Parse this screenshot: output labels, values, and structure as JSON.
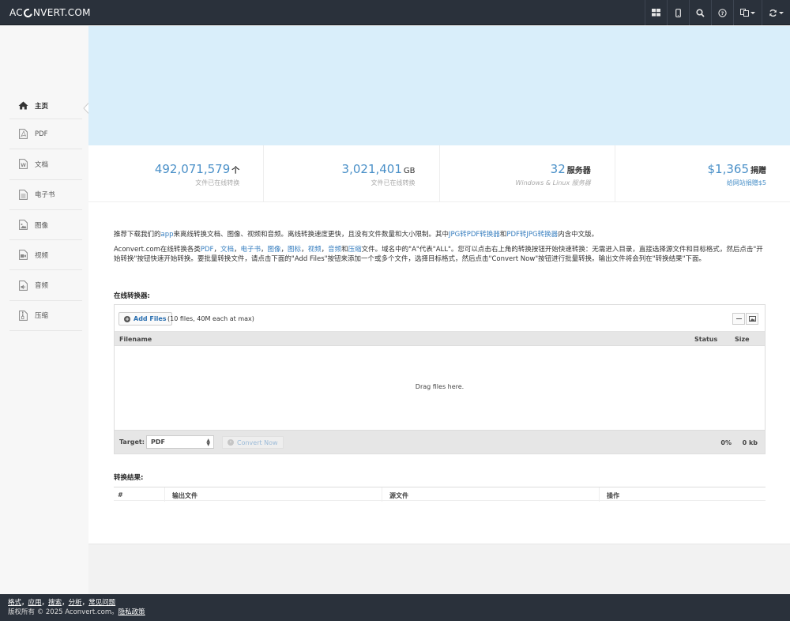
{
  "header": {
    "logo_left": "AC",
    "logo_right": "NVERT.COM"
  },
  "sidebar": {
    "items": [
      {
        "label": "主页",
        "icon": "home-icon"
      },
      {
        "label": "PDF",
        "icon": "pdf-file-icon"
      },
      {
        "label": "文档",
        "icon": "word-file-icon"
      },
      {
        "label": "电子书",
        "icon": "ebook-file-icon"
      },
      {
        "label": "图像",
        "icon": "image-file-icon"
      },
      {
        "label": "视频",
        "icon": "video-file-icon"
      },
      {
        "label": "音频",
        "icon": "audio-file-icon"
      },
      {
        "label": "压缩",
        "icon": "archive-file-icon"
      }
    ]
  },
  "stats": [
    {
      "value": "492,071,579",
      "unit": "个",
      "sub": "文件已在线转换"
    },
    {
      "value": "3,021,401",
      "unit": "GB",
      "sub": "文件已在线转换"
    },
    {
      "value": "32",
      "unit": "服务器",
      "sub": "Windows & Linux 服务器"
    },
    {
      "value": "$1,365",
      "unit": "捐赠",
      "sub": "给网站捐赠$5"
    }
  ],
  "intro": {
    "p1_a": "推荐下载我们的",
    "p1_app": "app",
    "p1_b": "来离线转换文档、图像、视频和音频。离线转换速度更快，且没有文件数量和大小限制。其中",
    "p1_link1": "JPG转PDF转换器",
    "p1_c": "和",
    "p1_link2": "PDF转JPG转换器",
    "p1_d": "内含中文版。",
    "p2_a": "Aconvert.com在线转换各类",
    "p2_pdf": "PDF",
    "p2_sep1": "，",
    "p2_doc": "文档",
    "p2_sep2": "，",
    "p2_ebook": "电子书",
    "p2_sep3": "，",
    "p2_image": "图像",
    "p2_sep4": "，",
    "p2_icon": "图标",
    "p2_sep5": "，",
    "p2_video": "视频",
    "p2_sep6": "，",
    "p2_audio": "音频",
    "p2_and": "和",
    "p2_archive": "压缩",
    "p2_b": "文件。域名中的\"A\"代表\"ALL\"。您可以点击右上角的转换按钮开始快速转换：无需进入目录，直接选择源文件和目标格式，然后点击\"开始转换\"按钮快速开始转换。要批量转换文件，请点击下面的\"Add Files\"按钮来添加一个或多个文件，选择目标格式，然后点击\"Convert Now\"按钮进行批量转换。输出文件将会列在\"转换结果\"下面。"
  },
  "converter": {
    "title": "在线转换器:",
    "add_files": "Add Files",
    "add_hint": "(10 files, 40M each at max)",
    "col_filename": "Filename",
    "col_status": "Status",
    "col_size": "Size",
    "drop_text": "Drag files here.",
    "target_label": "Target:",
    "target_value": "PDF",
    "convert_now": "Convert Now",
    "progress": "0%",
    "total_size": "0 kb"
  },
  "results": {
    "title": "转换结果:",
    "col_num": "#",
    "col_output": "输出文件",
    "col_source": "源文件",
    "col_action": "操作"
  },
  "footer": {
    "link1": "格式",
    "link2": "应用",
    "link3": "搜索",
    "link4": "分析",
    "link5": "常见问题",
    "separator": "，",
    "copyright": "版权所有 © 2025 Aconvert.com。",
    "privacy": "隐私政策"
  }
}
